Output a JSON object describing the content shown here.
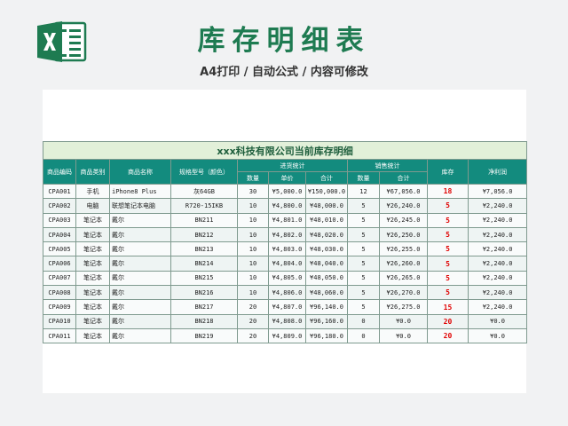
{
  "header": {
    "title": "库存明细表",
    "subtitle": "A4打印 / 自动公式 / 内容可修改"
  },
  "colors": {
    "accent": "#138b7e",
    "title_green": "#1e7b51",
    "caption_bg": "#e2f0d9",
    "alert_red": "#e00000"
  },
  "logo_icon": "excel-icon",
  "table": {
    "caption": "xxx科技有限公司当前库存明细",
    "headers": {
      "code": "商品编码",
      "category": "商品类别",
      "name": "商品名称",
      "spec": "规格型号（颜色）",
      "purchase_group": "进货统计",
      "sales_group": "销售统计",
      "stock": "库存",
      "profit": "净利润",
      "qty": "数量",
      "unit_price": "单价",
      "total": "合计"
    },
    "rows": [
      {
        "code": "CPA001",
        "category": "手机",
        "name": "iPhone8 Plus",
        "spec": "灰64GB",
        "pq": "30",
        "pp": "¥5,000.0",
        "pt": "¥150,000.0",
        "sq": "12",
        "st": "¥67,056.0",
        "stock": "18",
        "profit": "¥7,056.0"
      },
      {
        "code": "CPA002",
        "category": "电脑",
        "name": "联想笔记本电脑",
        "spec": "R720-15IKB",
        "pq": "10",
        "pp": "¥4,800.0",
        "pt": "¥48,000.0",
        "sq": "5",
        "st": "¥26,240.0",
        "stock": "5",
        "profit": "¥2,240.0"
      },
      {
        "code": "CPA003",
        "category": "笔记本",
        "name": "戴尔",
        "spec": "BN211",
        "pq": "10",
        "pp": "¥4,801.0",
        "pt": "¥48,010.0",
        "sq": "5",
        "st": "¥26,245.0",
        "stock": "5",
        "profit": "¥2,240.0"
      },
      {
        "code": "CPA004",
        "category": "笔记本",
        "name": "戴尔",
        "spec": "BN212",
        "pq": "10",
        "pp": "¥4,802.0",
        "pt": "¥48,020.0",
        "sq": "5",
        "st": "¥26,250.0",
        "stock": "5",
        "profit": "¥2,240.0"
      },
      {
        "code": "CPA005",
        "category": "笔记本",
        "name": "戴尔",
        "spec": "BN213",
        "pq": "10",
        "pp": "¥4,803.0",
        "pt": "¥48,030.0",
        "sq": "5",
        "st": "¥26,255.0",
        "stock": "5",
        "profit": "¥2,240.0"
      },
      {
        "code": "CPA006",
        "category": "笔记本",
        "name": "戴尔",
        "spec": "BN214",
        "pq": "10",
        "pp": "¥4,804.0",
        "pt": "¥48,040.0",
        "sq": "5",
        "st": "¥26,260.0",
        "stock": "5",
        "profit": "¥2,240.0"
      },
      {
        "code": "CPA007",
        "category": "笔记本",
        "name": "戴尔",
        "spec": "BN215",
        "pq": "10",
        "pp": "¥4,805.0",
        "pt": "¥48,050.0",
        "sq": "5",
        "st": "¥26,265.0",
        "stock": "5",
        "profit": "¥2,240.0"
      },
      {
        "code": "CPA008",
        "category": "笔记本",
        "name": "戴尔",
        "spec": "BN216",
        "pq": "10",
        "pp": "¥4,806.0",
        "pt": "¥48,060.0",
        "sq": "5",
        "st": "¥26,270.0",
        "stock": "5",
        "profit": "¥2,240.0"
      },
      {
        "code": "CPA009",
        "category": "笔记本",
        "name": "戴尔",
        "spec": "BN217",
        "pq": "20",
        "pp": "¥4,807.0",
        "pt": "¥96,140.0",
        "sq": "5",
        "st": "¥26,275.0",
        "stock": "15",
        "profit": "¥2,240.0"
      },
      {
        "code": "CPA010",
        "category": "笔记本",
        "name": "戴尔",
        "spec": "BN218",
        "pq": "20",
        "pp": "¥4,808.0",
        "pt": "¥96,160.0",
        "sq": "0",
        "st": "¥0.0",
        "stock": "20",
        "profit": "¥0.0"
      },
      {
        "code": "CPA011",
        "category": "笔记本",
        "name": "戴尔",
        "spec": "BN219",
        "pq": "20",
        "pp": "¥4,809.0",
        "pt": "¥96,180.0",
        "sq": "0",
        "st": "¥0.0",
        "stock": "20",
        "profit": "¥0.0"
      }
    ]
  }
}
